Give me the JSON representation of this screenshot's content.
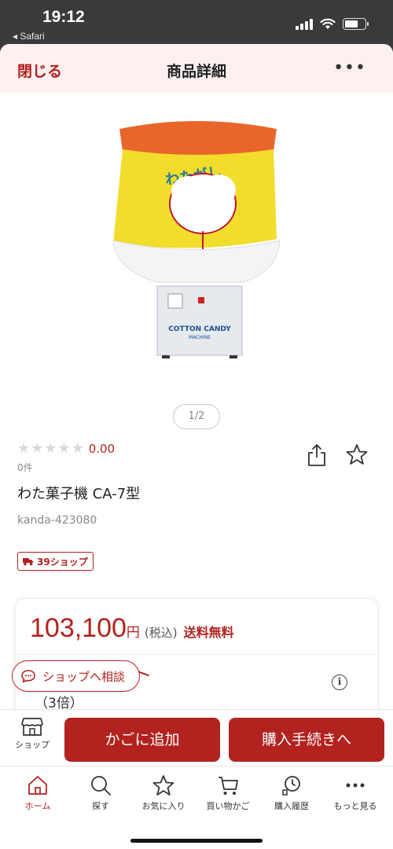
{
  "status": {
    "time": "19:12",
    "back_label": "◂ Safari",
    "battery_level": 0.65
  },
  "header": {
    "close_label": "閉じる",
    "title": "商品詳細",
    "more_icon": "more-icon"
  },
  "product": {
    "image_text_top": "わたがし",
    "image_text_machine": "COTTON CANDY",
    "image_text_machine_sub": "MACHINE",
    "pager": "1/2",
    "rating_stars": 0,
    "rating_value": "0.00",
    "review_count": "0件",
    "name": "わた菓子機 CA-7型",
    "sku": "kanda-423080",
    "badge": "39ショップ"
  },
  "price": {
    "amount": "103,100",
    "currency": "円",
    "tax_label": "(税込)",
    "shipping_label": "送料無料",
    "points_text": "（3倍）",
    "info_glyph": "i"
  },
  "consult": {
    "label": "ショップへ相談"
  },
  "actions": {
    "shop_label": "ショップ",
    "add_to_cart": "かごに追加",
    "checkout": "購入手続きへ"
  },
  "tabs": [
    {
      "label": "ホーム",
      "icon": "home-icon",
      "active": true
    },
    {
      "label": "探す",
      "icon": "search-icon",
      "active": false
    },
    {
      "label": "お気に入り",
      "icon": "star-icon",
      "active": false
    },
    {
      "label": "買い物かご",
      "icon": "cart-icon",
      "active": false
    },
    {
      "label": "購入履歴",
      "icon": "history-icon",
      "active": false
    },
    {
      "label": "もっと見る",
      "icon": "more-icon",
      "active": false
    }
  ],
  "colors": {
    "accent": "#b2221e",
    "header_bg": "#fdf0f0"
  }
}
